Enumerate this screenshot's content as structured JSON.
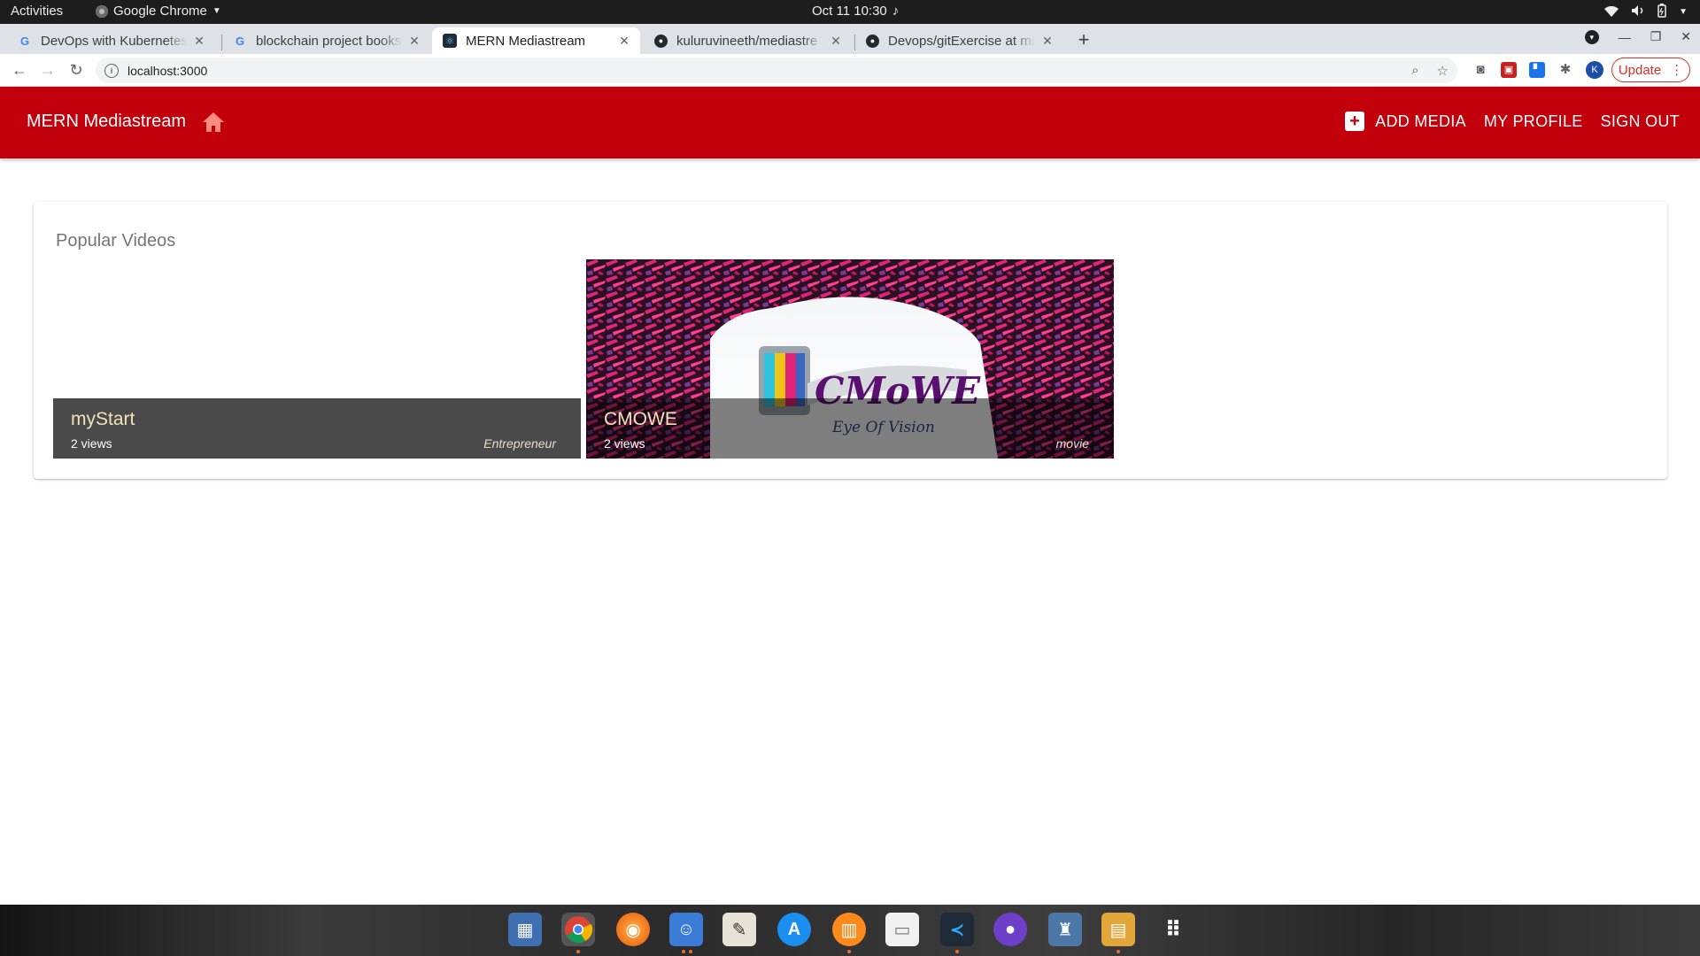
{
  "system": {
    "activities": "Activities",
    "app_name": "Google Chrome",
    "clock": "Oct 11  10:30"
  },
  "browser": {
    "tabs": [
      {
        "title": "DevOps with Kubernetes",
        "icon": "google-icon"
      },
      {
        "title": "blockchain project books",
        "icon": "google-icon"
      },
      {
        "title": "MERN Mediastream",
        "icon": "react-icon",
        "active": true
      },
      {
        "title": "kuluruvineeth/mediastre",
        "icon": "github-icon"
      },
      {
        "title": "Devops/gitExercise at ma",
        "icon": "github-icon"
      }
    ],
    "url": "localhost:3000",
    "update_label": "Update",
    "profile_initial": "K"
  },
  "app": {
    "brand": "MERN Mediastream",
    "nav": {
      "add_media": "ADD MEDIA",
      "my_profile": "MY PROFILE",
      "sign_out": "SIGN OUT"
    },
    "accent_color": "#c2000b",
    "section_title": "Popular Videos",
    "videos": [
      {
        "title": "myStart",
        "views": "2 views",
        "genre": "Entrepreneur"
      },
      {
        "title": "CMOWE",
        "views": "2 views",
        "genre": "movie"
      }
    ]
  }
}
